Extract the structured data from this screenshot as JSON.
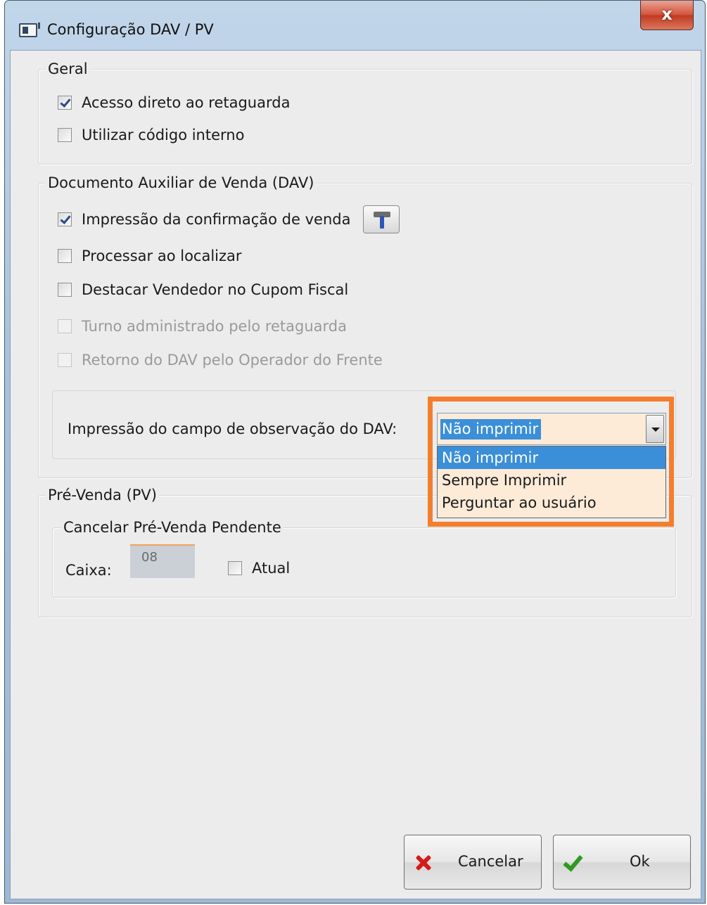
{
  "window": {
    "title": "Configuração DAV / PV",
    "close_label": "x"
  },
  "geral": {
    "legend": "Geral",
    "items": [
      {
        "label": "Acesso direto ao retaguarda",
        "checked": true,
        "enabled": true
      },
      {
        "label": "Utilizar código interno",
        "checked": false,
        "enabled": true
      }
    ]
  },
  "dav": {
    "legend": "Documento Auxiliar de Venda (DAV)",
    "items": [
      {
        "label": "Impressão da confirmação de venda",
        "checked": true,
        "enabled": true
      },
      {
        "label": "Processar ao localizar",
        "checked": false,
        "enabled": true
      },
      {
        "label": "Destacar Vendedor no Cupom Fiscal",
        "checked": false,
        "enabled": true
      },
      {
        "label": "Turno administrado pelo retaguarda",
        "checked": false,
        "enabled": false
      },
      {
        "label": "Retorno do DAV pelo Operador do Frente",
        "checked": false,
        "enabled": false
      }
    ],
    "settings_icon": "hammer-icon",
    "observacao": {
      "label": "Impressão do campo de observação do DAV:",
      "selected": "Não imprimir",
      "options": [
        "Não imprimir",
        "Sempre Imprimir",
        "Perguntar ao usuário"
      ],
      "highlight_color": "#f47e2d"
    }
  },
  "pv": {
    "legend": "Pré-Venda (PV)",
    "cancel_group": {
      "legend": "Cancelar Pré-Venda Pendente",
      "caixa_label": "Caixa:",
      "caixa_value": "08",
      "atual_label": "Atual",
      "atual_checked": false
    }
  },
  "buttons": {
    "cancel_label": "Cancelar",
    "ok_label": "Ok"
  }
}
